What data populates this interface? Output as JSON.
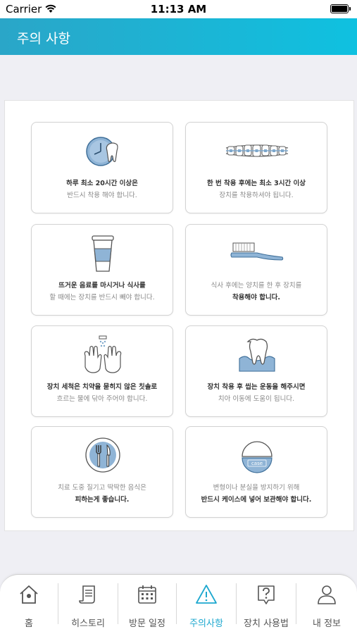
{
  "status_bar": {
    "carrier": "Carrier",
    "time": "11:13 AM"
  },
  "header": {
    "title": "주의 사항"
  },
  "tiles": [
    {
      "line1": "하루 최소 20시간 이상은",
      "line2": "반드시 착용 해야 합니다.",
      "icon": "clock-tooth-icon"
    },
    {
      "line1": "한 번 착용 후에는 최소 3시간 이상",
      "line2": "장치를 착용하셔야 됩니다.",
      "icon": "braces-icon"
    },
    {
      "line1": "뜨거운 음료를 마시거나 식사를",
      "line2": "할 때에는 장치를 반드시 빼야 합니다.",
      "icon": "hot-cup-icon"
    },
    {
      "line1": "식사 후에는 양치를 한 후 장치를",
      "line2": "착용해야 합니다.",
      "icon": "toothbrush-icon"
    },
    {
      "line1": "장치 세척은 치약을 묻히지 않은 칫솔로",
      "line2": "흐르는 물에 닦아 주어야 합니다.",
      "icon": "washing-hands-icon"
    },
    {
      "line1": "장치 착용 후 씹는 운동을 해주시면",
      "line2": "치아 이동에 도움이 됩니다.",
      "icon": "tooth-gum-icon"
    },
    {
      "line1": "치료 도중 질기고 딱딱한 음식은",
      "line2": "피하는게 좋습니다.",
      "icon": "fork-knife-icon"
    },
    {
      "line1": "변형이나 분실을 방지하기 위해",
      "line2": "반드시 케이스에 넣어 보관해야 합니다.",
      "icon": "case-icon",
      "case_text": "case"
    }
  ],
  "tabs": [
    {
      "label": "홈",
      "icon": "home-icon",
      "active": false
    },
    {
      "label": "히스토리",
      "icon": "scroll-icon",
      "active": false
    },
    {
      "label": "방문 일정",
      "icon": "calendar-icon",
      "active": false
    },
    {
      "label": "주의사항",
      "icon": "warning-icon",
      "active": true
    },
    {
      "label": "장치 사용법",
      "icon": "question-icon",
      "active": false
    },
    {
      "label": "내 정보",
      "icon": "person-icon",
      "active": false
    }
  ],
  "colors": {
    "header_start": "#2aa6c8",
    "header_end": "#0fc1e0",
    "accent": "#1da8cf",
    "icon_blue": "#7ea8cc"
  }
}
